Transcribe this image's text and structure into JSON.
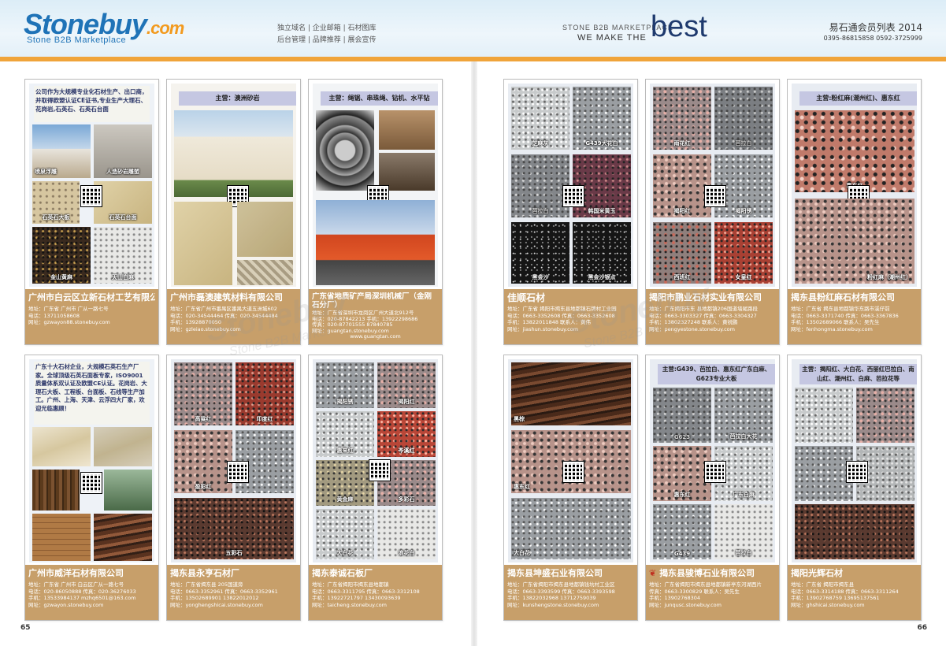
{
  "header": {
    "logo": "Stonebuy",
    "logo_tld": ".com",
    "logo_sub": "Stone B2B Marketplace",
    "links_line1": "独立域名 | 企业邮箱 | 石材图库",
    "links_line2": "后台管理 | 品牌推荐 | 展会宣传",
    "slogan_small": "STONE B2B MARKETPLACE",
    "slogan_we": "WE MAKE THE",
    "slogan_best": "best",
    "issue_title": "易石通会员列表 2014",
    "issue_phones": "0395-86815858   0592-3725999"
  },
  "page_left_num": "65",
  "page_right_num": "66",
  "watermark": "Stonebuy",
  "watermark_sub": "Stone B2B Market",
  "cards": [
    {
      "name": "广州市白云区立新石材工艺有限公司",
      "intro": "公司作为大规模专业化石材生产、出口商，并取得欧盟认证CE证书,专业生产大理石、花岗岩,石英石、石英石台面",
      "tiles": [
        "喷泉浮雕",
        "人造砂岩雕塑",
        "石英石大板",
        "石英石台面",
        "金山黄麻",
        "天山白麻"
      ],
      "info": [
        "地址：广东省 广州市 广从一路七号",
        "电话：13711058608",
        "网址：gzwayon88.stonebuy.com"
      ]
    },
    {
      "name": "广州市磊澳建筑材料有限公司",
      "banner": "主营：澳洲砂岩",
      "info": [
        "地址：广东省广州市番禺区番禺大道五洲城602",
        "电话：020-34544464   传真：020-34544484",
        "手机：13928870050",
        "网址：gzleiao.stonebuy.com"
      ]
    },
    {
      "name": "广东省地质矿产局深圳机械厂（金刚石分厂）",
      "banner": "主营：绳锯、串珠绳、钻机、水平钻",
      "info": [
        "地址：广东省深圳市龙岗区广州大道北912号",
        "电话：020-87842213   手机：13922298686",
        "传真：020-87701555   87840785",
        "网址：guangtan.stonebuy.com",
        "www.guangtan.com"
      ]
    },
    {
      "name": "广州市威洋石材有限公司",
      "intro": "广东十大石材企业，大规模石英石生产厂家。全球顶级石英石面板专家，ISO9001质量体系双认证及欧盟CE认证。花岗岩、大理石大板、工程板、台面板、石线等生产加工。广州、上海、天津、云浮四大厂家，欢迎光临惠顾！",
      "info": [
        "地址：广东省 广州市 白云区广从一路七号",
        "电话：020-86050888   传真：020-36276033",
        "手机：13533984137   mzhq6501@163.com",
        "网址：gzwayon.stonebuy.com"
      ]
    },
    {
      "name": "揭东县永亨石材厂",
      "tiles": [
        "高粱红",
        "印度红",
        "盈彩红",
        "",
        "",
        "五彩石"
      ],
      "info": [
        "地址：广东省揭东县 205国道旁",
        "电话：0663-3352961   传真：0663-3352961",
        "手机：13502689901   13822012012",
        "网址：yonghengshicai.stonebuy.com"
      ]
    },
    {
      "name": "揭东泰诚石板厂",
      "tiles": [
        "揭阳锈",
        "揭阳红",
        "惠来红",
        "岑溪红",
        "黄金麻",
        "多彩石",
        "大白花",
        "浪花白"
      ],
      "info": [
        "地址：广东省揭阳市揭东县地都镇",
        "电话：0663-3311795   传真：0663-3312108",
        "手机：13922721797   13430093639",
        "网址：taicheng.stonebuy.com"
      ]
    },
    {
      "name": "佳顺石材",
      "tiles": [
        "芝麻灰",
        "G439大花白",
        "芭拉白",
        "韩国米黄玉",
        "黑金沙",
        "黑金沙银点"
      ],
      "info": [
        "地址：广东省 揭阳市揭东县地都镇石牌村工业园",
        "电话：0663-3352608   传真：0663-3352608",
        "手机：13822011848   联系人：黄伟",
        "网址：jiashun.stonebuy.com"
      ]
    },
    {
      "name": "揭阳市鹏业石材实业有限公司",
      "tiles": [
        "雨花红",
        "芭拉白",
        "揭阳红",
        "揭阳锈",
        "西班红",
        "女皇红"
      ],
      "info": [
        "地址：广东揭阳市东 县地都镇206国道墙尾路段",
        "电话：0663-3303327   传真：0663-3304327",
        "手机：13802327248   联系人：黄锐鹏",
        "网址：pengyestone.stonebuy.com"
      ]
    },
    {
      "name": "揭东县粉红麻石材有限公司",
      "banner": "主营:粉红麻(潮州红)、惠东红",
      "tiles": [
        "惠东红",
        "粉红麻（潮州红）"
      ],
      "info": [
        "地址：广东省 揭东县地都镇华东路市溪仔前",
        "电话：0663-3371740   传真：0663-3367836",
        "手机：13502689066   联系人：吴先生",
        "网址：fenhongma.stonebuy.com"
      ]
    },
    {
      "name": "揭东县坤盛石业有限公司",
      "tiles": [
        "黑棕",
        "惠东红",
        "大白花"
      ],
      "info": [
        "地址：广东省揭阳市揭东县地都镇钱坑村工业区",
        "电话：0663-3393599   传真：0663-3393598",
        "手机：13822032968   13712759039",
        "网址：kunshengstone.stonebuy.com"
      ]
    },
    {
      "name": "揭东县骏博石业有限公司",
      "banner": "主营:G439、芭拉白、惠东红广东白麻、G623专业大板",
      "tiles": [
        "G623",
        "芭拉白大花",
        "惠东红",
        "广东白麻",
        "G439",
        "芭拉白"
      ],
      "info": [
        "地址：广东省揭阳市揭东县地都镇新亭东河湖西片",
        "传真：0663-3300829   联系人：吴先生",
        "手机：13902768304",
        "网址：junqusc.stonebuy.com"
      ]
    },
    {
      "name": "揭阳光辉石材",
      "banner": "主营：揭阳红、大白花、西丽红巴拉白、南山红、潮州红、白麻、芭拉花等",
      "info": [
        "地址：广东省 揭阳市揭东县",
        "电话：0663-3314188   传真：0663-3311264",
        "手机：13902768759   13695137561",
        "网址：ghshicai.stonebuy.com"
      ]
    }
  ]
}
